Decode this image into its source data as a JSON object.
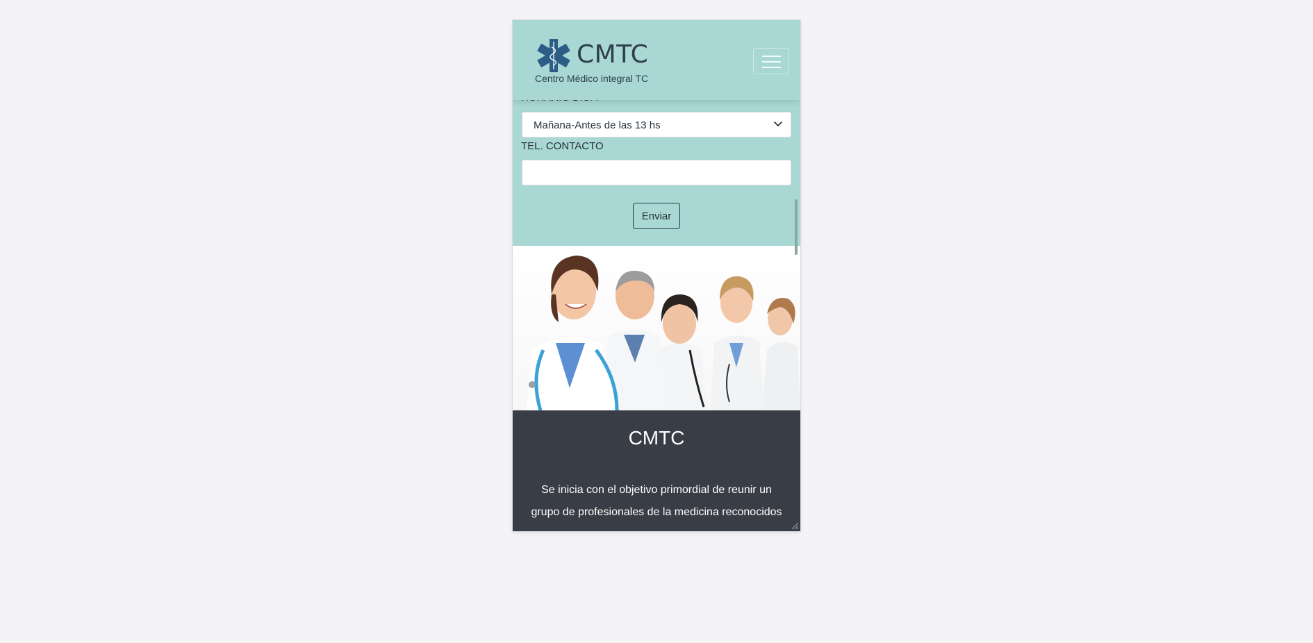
{
  "brand": {
    "name": "CMTC",
    "subtitle": "Centro Médico integral TC"
  },
  "form": {
    "partial_label": "HORARIO DISP.",
    "schedule_select_value": "Mañana-Antes de las 13 hs",
    "phone_label": "TEL. CONTACTO",
    "phone_value": "",
    "submit_label": "Enviar"
  },
  "about": {
    "title": "CMTC",
    "text": "Se inicia con el objetivo primordial de reunir un grupo de profesionales de la medicina reconocidos"
  },
  "icons": {
    "logo": "star-of-life-icon",
    "menu": "hamburger-icon",
    "select_arrow": "chevron-down-icon",
    "resize": "resize-grip-icon"
  },
  "colors": {
    "navbar_bg": "#a9d7d3",
    "about_bg": "#393d45",
    "logo_blue": "#2b5d86",
    "text_dark": "#27323a"
  }
}
